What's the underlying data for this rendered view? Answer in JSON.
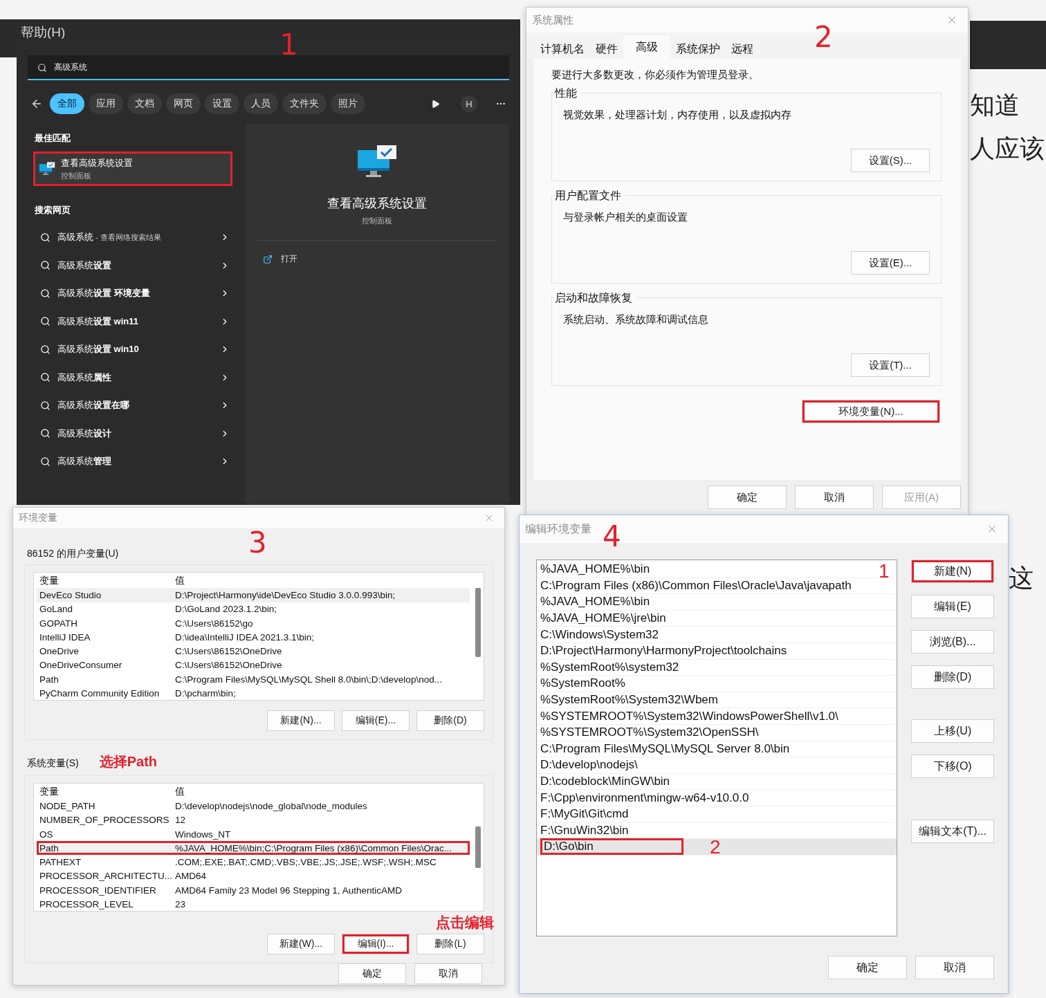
{
  "background": {
    "menu_label": "帮助(H)",
    "side_texts": [
      "知道",
      "人应该"
    ],
    "side_text_lower": "这"
  },
  "search_panel": {
    "step_label": "1",
    "query": "高级系统",
    "filters": [
      {
        "label": "全部",
        "selected": true
      },
      {
        "label": "应用",
        "selected": false
      },
      {
        "label": "文档",
        "selected": false
      },
      {
        "label": "网页",
        "selected": false
      },
      {
        "label": "设置",
        "selected": false
      },
      {
        "label": "人员",
        "selected": false
      },
      {
        "label": "文件夹",
        "selected": false
      },
      {
        "label": "照片",
        "selected": false
      }
    ],
    "account_initial": "H",
    "best_match_heading": "最佳匹配",
    "best_match": {
      "title": "查看高级系统设置",
      "subtitle": "控制面板",
      "highlighted": true
    },
    "web_heading": "搜索网页",
    "web_results": [
      {
        "text": "高级系统",
        "suffix": "- 查看网络搜索结果"
      },
      {
        "text": "高级系统**设置**"
      },
      {
        "text": "高级系统**设置 环境变量**"
      },
      {
        "text": "高级系统**设置 win11**"
      },
      {
        "text": "高级系统**设置 win10**"
      },
      {
        "text": "高级系统**属性**"
      },
      {
        "text": "高级系统**设置在哪**"
      },
      {
        "text": "高级系统**设计**"
      },
      {
        "text": "高级系统**管理**"
      }
    ],
    "preview": {
      "title": "查看高级系统设置",
      "subtitle": "控制面板",
      "action": "打开"
    }
  },
  "system_properties": {
    "title": "系统属性",
    "step_label": "2",
    "tabs": [
      {
        "label": "计算机名",
        "selected": false
      },
      {
        "label": "硬件",
        "selected": false
      },
      {
        "label": "高级",
        "selected": true
      },
      {
        "label": "系统保护",
        "selected": false
      },
      {
        "label": "远程",
        "selected": false
      }
    ],
    "notice": "要进行大多数更改，你必须作为管理员登录。",
    "groups": [
      {
        "title": "性能",
        "description": "视觉效果，处理器计划，内存使用，以及虚拟内存",
        "button": "设置(S)..."
      },
      {
        "title": "用户配置文件",
        "description": "与登录帐户相关的桌面设置",
        "button": "设置(E)..."
      },
      {
        "title": "启动和故障恢复",
        "description": "系统启动、系统故障和调试信息",
        "button": "设置(T)..."
      }
    ],
    "env_button": {
      "label": "环境变量(N)...",
      "highlighted": true
    },
    "footer_buttons": [
      {
        "label": "确定",
        "disabled": false
      },
      {
        "label": "取消",
        "disabled": false
      },
      {
        "label": "应用(A)",
        "disabled": true
      }
    ]
  },
  "environment_variables": {
    "title": "环境变量",
    "step_label": "3",
    "sections": [
      {
        "heading": "86152 的用户变量(U)",
        "columns": [
          "变量",
          "值"
        ],
        "rows": [
          {
            "name": "DevEco Studio",
            "value": "D:\\Project\\Harmony\\ide\\DevEco Studio 3.0.0.993\\bin;",
            "selected": true,
            "highlighted": false
          },
          {
            "name": "GoLand",
            "value": "D:\\GoLand 2023.1.2\\bin;",
            "selected": false,
            "highlighted": false
          },
          {
            "name": "GOPATH",
            "value": "C:\\Users\\86152\\go",
            "selected": false,
            "highlighted": false
          },
          {
            "name": "IntelliJ IDEA",
            "value": "D:\\idea\\IntelliJ IDEA 2021.3.1\\bin;",
            "selected": false,
            "highlighted": false
          },
          {
            "name": "OneDrive",
            "value": "C:\\Users\\86152\\OneDrive",
            "selected": false,
            "highlighted": false
          },
          {
            "name": "OneDriveConsumer",
            "value": "C:\\Users\\86152\\OneDrive",
            "selected": false,
            "highlighted": false
          },
          {
            "name": "Path",
            "value": "C:\\Program Files\\MySQL\\MySQL Shell 8.0\\bin\\;D:\\develop\\nod...",
            "selected": false,
            "highlighted": false
          },
          {
            "name": "PyCharm Community Edition",
            "value": "D:\\pcharm\\bin;",
            "selected": false,
            "highlighted": false
          }
        ],
        "buttons": [
          {
            "label": "新建(N)...",
            "highlighted": false
          },
          {
            "label": "编辑(E)...",
            "highlighted": false
          },
          {
            "label": "删除(D)",
            "highlighted": false
          }
        ]
      },
      {
        "heading": "系统变量(S)",
        "columns": [
          "变量",
          "值"
        ],
        "annotation": "选择Path",
        "rows": [
          {
            "name": "NODE_PATH",
            "value": "D:\\develop\\nodejs\\node_global\\node_modules",
            "selected": false,
            "highlighted": false
          },
          {
            "name": "NUMBER_OF_PROCESSORS",
            "value": "12",
            "selected": false,
            "highlighted": false
          },
          {
            "name": "OS",
            "value": "Windows_NT",
            "selected": false,
            "highlighted": false
          },
          {
            "name": "Path",
            "value": "%JAVA_HOME%\\bin;C:\\Program Files (x86)\\Common Files\\Orac...",
            "selected": true,
            "highlighted": true
          },
          {
            "name": "PATHEXT",
            "value": ".COM;.EXE;.BAT;.CMD;.VBS;.VBE;.JS;.JSE;.WSF;.WSH;.MSC",
            "selected": false,
            "highlighted": false
          },
          {
            "name": "PROCESSOR_ARCHITECTU...",
            "value": "AMD64",
            "selected": false,
            "highlighted": false
          },
          {
            "name": "PROCESSOR_IDENTIFIER",
            "value": "AMD64 Family 23 Model 96 Stepping 1, AuthenticAMD",
            "selected": false,
            "highlighted": false
          },
          {
            "name": "PROCESSOR_LEVEL",
            "value": "23",
            "selected": false,
            "highlighted": false
          }
        ],
        "buttons": [
          {
            "label": "新建(W)...",
            "highlighted": false
          },
          {
            "label": "编辑(I)...",
            "highlighted": true
          },
          {
            "label": "删除(L)",
            "highlighted": false
          }
        ]
      }
    ],
    "button_annotation": "点击编辑",
    "footer_buttons": [
      "确定",
      "取消"
    ]
  },
  "edit_environment_variable": {
    "title": "编辑环境变量",
    "step_label": "4",
    "entries": [
      {
        "text": "%JAVA_HOME%\\bin",
        "selected": false,
        "highlighted": false
      },
      {
        "text": "C:\\Program Files (x86)\\Common Files\\Oracle\\Java\\javapath",
        "selected": false,
        "highlighted": false
      },
      {
        "text": "%JAVA_HOME%\\bin",
        "selected": false,
        "highlighted": false
      },
      {
        "text": "%JAVA_HOME%\\jre\\bin",
        "selected": false,
        "highlighted": false
      },
      {
        "text": "C:\\Windows\\System32",
        "selected": false,
        "highlighted": false
      },
      {
        "text": "D:\\Project\\Harmony\\HarmonyProject\\toolchains",
        "selected": false,
        "highlighted": false
      },
      {
        "text": "%SystemRoot%\\system32",
        "selected": false,
        "highlighted": false
      },
      {
        "text": "%SystemRoot%",
        "selected": false,
        "highlighted": false
      },
      {
        "text": "%SystemRoot%\\System32\\Wbem",
        "selected": false,
        "highlighted": false
      },
      {
        "text": "%SYSTEMROOT%\\System32\\WindowsPowerShell\\v1.0\\",
        "selected": false,
        "highlighted": false
      },
      {
        "text": "%SYSTEMROOT%\\System32\\OpenSSH\\",
        "selected": false,
        "highlighted": false
      },
      {
        "text": "C:\\Program Files\\MySQL\\MySQL Server 8.0\\bin",
        "selected": false,
        "highlighted": false
      },
      {
        "text": "D:\\develop\\nodejs\\",
        "selected": false,
        "highlighted": false
      },
      {
        "text": "D:\\codeblock\\MinGW\\bin",
        "selected": false,
        "highlighted": false
      },
      {
        "text": "F:\\Cpp\\environment\\mingw-w64-v10.0.0",
        "selected": false,
        "highlighted": false
      },
      {
        "text": "F:\\MyGit\\Git\\cmd",
        "selected": false,
        "highlighted": false
      },
      {
        "text": "F:\\GnuWin32\\bin",
        "selected": false,
        "highlighted": false
      },
      {
        "text": "D:\\Go\\bin",
        "selected": true,
        "highlighted": true,
        "marker": "2"
      }
    ],
    "list_marker": "1",
    "button_groups": [
      [
        {
          "label": "新建(N)",
          "highlighted": true
        },
        {
          "label": "编辑(E)",
          "highlighted": false
        },
        {
          "label": "浏览(B)...",
          "highlighted": false
        },
        {
          "label": "删除(D)",
          "highlighted": false
        }
      ],
      [
        {
          "label": "上移(U)",
          "highlighted": false
        },
        {
          "label": "下移(O)",
          "highlighted": false
        }
      ],
      [
        {
          "label": "编辑文本(T)...",
          "highlighted": false
        }
      ]
    ],
    "footer_buttons": [
      "确定",
      "取消"
    ]
  }
}
